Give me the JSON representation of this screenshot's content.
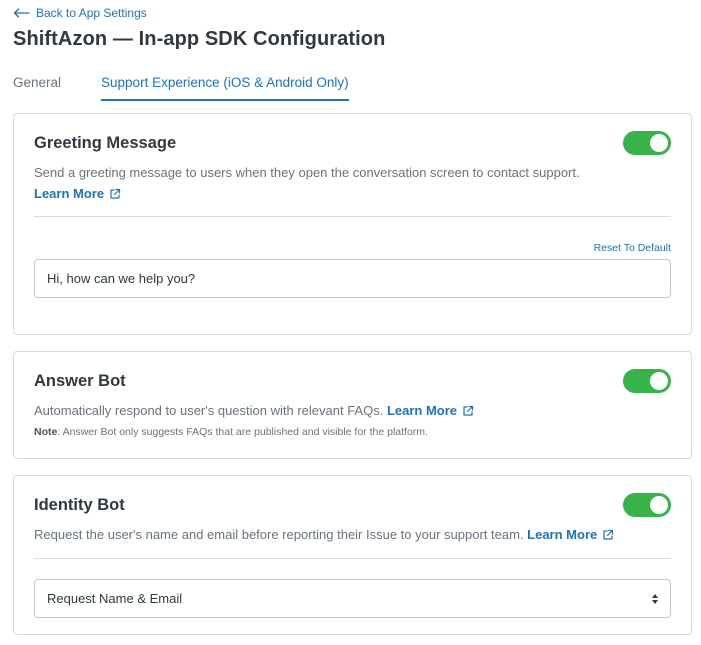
{
  "nav": {
    "back_label": "Back to App Settings"
  },
  "page": {
    "title": "ShiftAzon — In-app SDK Configuration"
  },
  "tabs": [
    {
      "label": "General",
      "active": false
    },
    {
      "label": "Support Experience (iOS & Android Only)",
      "active": true
    }
  ],
  "greeting": {
    "title": "Greeting Message",
    "enabled": true,
    "description": "Send a greeting message to users when they open the conversation screen to contact support.",
    "learn_more": "Learn More",
    "reset_label": "Reset To Default",
    "message_value": "Hi, how can we help you?"
  },
  "answer_bot": {
    "title": "Answer Bot",
    "enabled": true,
    "description": "Automatically respond to user's question with relevant FAQs.",
    "learn_more": "Learn More",
    "note_label": "Note",
    "note_text": ": Answer Bot only suggests FAQs that are published and visible for the platform."
  },
  "identity_bot": {
    "title": "Identity Bot",
    "enabled": true,
    "description": "Request the user's name and email before reporting their Issue to your support team.",
    "learn_more": "Learn More",
    "select_value": "Request Name & Email"
  },
  "colors": {
    "accent": "#1f73b7",
    "toggle_on": "#37b34a",
    "border": "#d8dcde",
    "muted_text": "#68737d"
  },
  "icons": {
    "back": "arrow-left-icon",
    "external": "external-link-icon",
    "select": "select-caret-icon"
  }
}
